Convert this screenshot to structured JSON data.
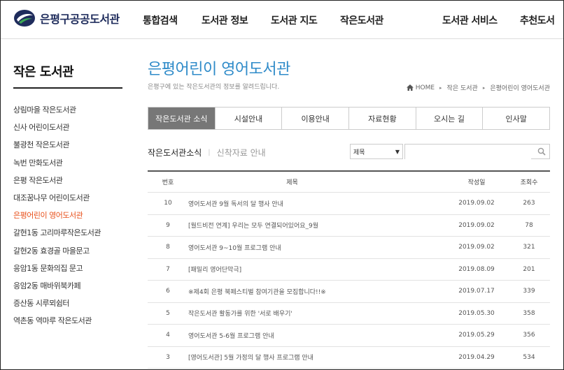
{
  "header": {
    "logo_text": "은평구공공도서관",
    "nav": [
      "통합검색",
      "도서관 정보",
      "도서관 지도",
      "작은도서관",
      "도서관 서비스",
      "추천도서"
    ]
  },
  "sidebar": {
    "title": "작은 도서관",
    "items": [
      {
        "label": "상림마을 작은도서관"
      },
      {
        "label": "신사 어린이도서관"
      },
      {
        "label": "불광천 작은도서관"
      },
      {
        "label": "녹번 만화도서관"
      },
      {
        "label": "은평 작은도서관"
      },
      {
        "label": "대조꿈나무 어린이도서관"
      },
      {
        "label": "은평어린이 영어도서관",
        "active": true
      },
      {
        "label": "갈현1동 고리마루작은도서관"
      },
      {
        "label": "갈현2동 효경골 마을문고"
      },
      {
        "label": "응암1동 문화의집 문고"
      },
      {
        "label": "응암2동 매바위북카페"
      },
      {
        "label": "증산동 시루뫼쉼터"
      },
      {
        "label": "역촌동 역마루 작은도서관"
      }
    ]
  },
  "main": {
    "title": "은평어린이 영어도서관",
    "subtitle": "은평구에 있는 작은도서관의 정보를 알려드립니다.",
    "breadcrumb": [
      "HOME",
      "작은 도서관",
      "은평어린이 영어도서관"
    ],
    "tabs": [
      "작은도서관 소식",
      "시설안내",
      "이용안내",
      "자료현황",
      "오시는 길",
      "인사말"
    ],
    "active_tab": 0,
    "subtabs": {
      "active": "작은도서관소식",
      "other": "신착자료 안내"
    },
    "search": {
      "select_value": "제목",
      "placeholder": ""
    }
  },
  "board": {
    "columns": [
      "번호",
      "제목",
      "작성일",
      "조회수"
    ],
    "rows": [
      {
        "no": "10",
        "title": "영어도서관 9월 독서의 달 행사 안내",
        "date": "2019.09.02",
        "views": "263"
      },
      {
        "no": "9",
        "title": "[월드비전 연계] 우리는 모두 연결되어있어요_9월",
        "date": "2019.09.02",
        "views": "78"
      },
      {
        "no": "8",
        "title": "영어도서관 9~10월 프로그램 안내",
        "date": "2019.09.02",
        "views": "321"
      },
      {
        "no": "7",
        "title": "[패밀리 영어단막극]",
        "date": "2019.08.09",
        "views": "201"
      },
      {
        "no": "6",
        "title": "※제4회 은평 북페스티벌 참여기관을 모집합니다!!※",
        "date": "2019.07.17",
        "views": "339"
      },
      {
        "no": "5",
        "title": "작은도서관 활동가를 위한 '서로 배우기'",
        "date": "2019.05.30",
        "views": "358"
      },
      {
        "no": "4",
        "title": "영어도서관 5-6월 프로그램 안내",
        "date": "2019.05.29",
        "views": "356"
      },
      {
        "no": "3",
        "title": "[영어도서관] 5월 가정의 달 행사 프로그램 안내",
        "date": "2019.04.29",
        "views": "534"
      }
    ]
  },
  "colors": {
    "accent": "#2f8bc9",
    "active_side": "#e8511c",
    "tab_active_bg": "#777777",
    "logo": "#1f2c5c"
  }
}
